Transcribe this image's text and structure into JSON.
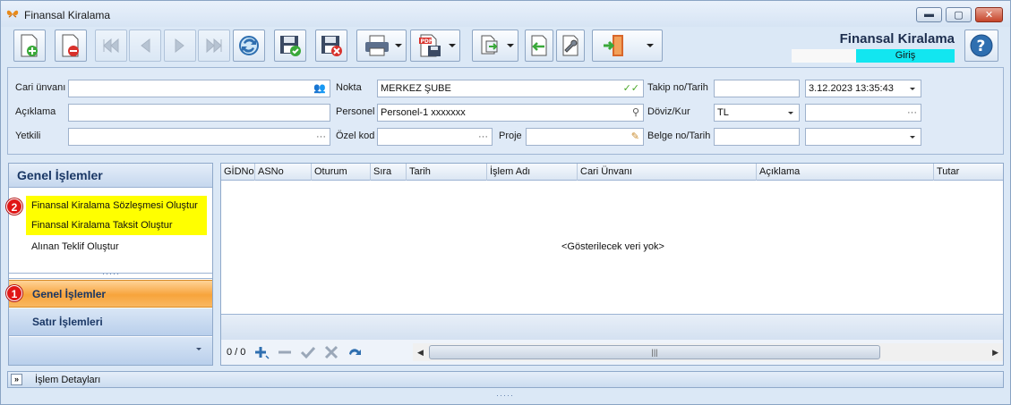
{
  "window": {
    "title": "Finansal Kiralama",
    "icons": {
      "app": "butterfly-icon",
      "minimize": "minimize-icon",
      "maximize": "maximize-icon",
      "close": "close-icon"
    }
  },
  "toolbar": {
    "brand_title": "Finansal Kiralama",
    "mode": "Giriş",
    "buttons": [
      {
        "name": "new-document",
        "icon": "new-doc-icon"
      },
      {
        "name": "delete-document",
        "icon": "delete-doc-icon"
      },
      {
        "name": "first-record",
        "icon": "first-icon",
        "disabled": true
      },
      {
        "name": "previous-record",
        "icon": "prev-icon",
        "disabled": true
      },
      {
        "name": "next-record",
        "icon": "next-icon",
        "disabled": true
      },
      {
        "name": "last-record",
        "icon": "last-icon",
        "disabled": true
      },
      {
        "name": "refresh",
        "icon": "refresh-icon"
      },
      {
        "name": "save",
        "icon": "save-icon"
      },
      {
        "name": "save-cancel",
        "icon": "save-cancel-icon"
      },
      {
        "name": "print",
        "icon": "printer-icon"
      },
      {
        "name": "pdf-export",
        "icon": "pdf-icon"
      },
      {
        "name": "export",
        "icon": "export-icon"
      },
      {
        "name": "import",
        "icon": "import-icon"
      },
      {
        "name": "settings",
        "icon": "wrench-icon"
      },
      {
        "name": "exit",
        "icon": "exit-door-icon"
      },
      {
        "name": "help",
        "icon": "help-icon"
      }
    ]
  },
  "form": {
    "cari_unvani": {
      "label": "Cari ünvanı",
      "value": ""
    },
    "aciklama": {
      "label": "Açıklama",
      "value": ""
    },
    "yetkili": {
      "label": "Yetkili",
      "value": ""
    },
    "nokta": {
      "label": "Nokta",
      "value": "MERKEZ ŞUBE"
    },
    "personel": {
      "label": "Personel",
      "value": "Personel-1 xxxxxxx"
    },
    "ozel_kod": {
      "label": "Özel kod",
      "value": ""
    },
    "proje": {
      "label": "Proje",
      "value": ""
    },
    "takip": {
      "label": "Takip no/Tarih",
      "no": "",
      "date": "3.12.2023 13:35:43"
    },
    "doviz": {
      "label": "Döviz/Kur",
      "currency": "TL",
      "rate": ""
    },
    "belge": {
      "label": "Belge no/Tarih",
      "no": "",
      "date": " .  .       :  :"
    },
    "ellipsis": "···"
  },
  "nav": {
    "header": "Genel İşlemler",
    "items": [
      {
        "label": "Finansal Kiralama Sözleşmesi Oluştur",
        "highlighted": true
      },
      {
        "label": "Finansal Kiralama Taksit Oluştur",
        "highlighted": true
      },
      {
        "label": "Alınan Teklif Oluştur",
        "highlighted": false
      }
    ],
    "groups": [
      {
        "label": "Genel İşlemler",
        "active": true
      },
      {
        "label": "Satır İşlemleri",
        "active": false
      }
    ],
    "splitter_dots": "·····",
    "badge1": "1",
    "badge2": "2"
  },
  "grid": {
    "columns": [
      "GİDNo",
      "ASNo",
      "Oturum",
      "Sıra",
      "Tarih",
      "İşlem Adı",
      "Cari Ünvanı",
      "Açıklama",
      "Tutar"
    ],
    "empty_text": "<Gösterilecek veri yok>",
    "record_count": "0 / 0",
    "nav_icons": [
      "add-icon",
      "remove-icon",
      "check-icon",
      "cancel-icon",
      "undo-icon"
    ],
    "scroll_thumb": "|||"
  },
  "bottom": {
    "label": "İşlem Detayları",
    "splitter_dots": "·····"
  },
  "colors": {
    "highlight": "#ffff00",
    "mode_badge": "#12e6f0",
    "active_group": "#f7a43c",
    "badge": "#e01717"
  }
}
